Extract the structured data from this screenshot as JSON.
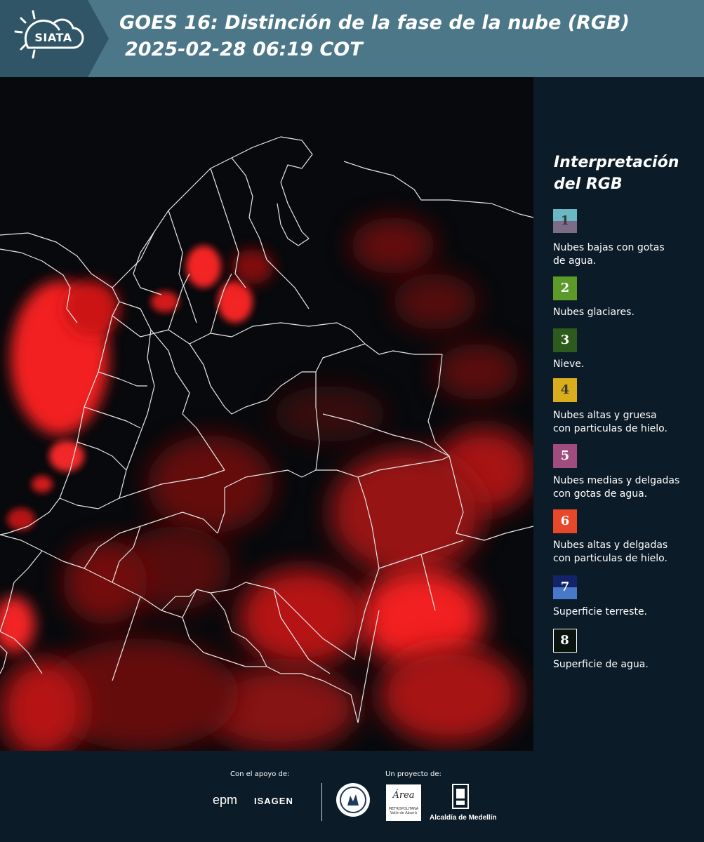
{
  "header": {
    "logo_text": "SIATA",
    "title_line1": "GOES 16: Distinción de la fase de la nube (RGB)",
    "title_line2": "2025-02-28 06:19 COT"
  },
  "legend": {
    "title_line1": "Interpretación",
    "title_line2": "del RGB",
    "items": [
      {
        "num": "1",
        "label_line1": "Nubes bajas con gotas",
        "label_line2": "de agua.",
        "color_top": "#6ab8c3",
        "color_bottom": "#7c6c88",
        "num_color": "#3a3a3a"
      },
      {
        "num": "2",
        "label_line1": "Nubes glaciares.",
        "label_line2": "",
        "color_top": "#5c9a2a",
        "color_bottom": "#5c9a2a",
        "num_color": "#ffffff"
      },
      {
        "num": "3",
        "label_line1": "Nieve.",
        "label_line2": "",
        "color_top": "#2d5a1d",
        "color_bottom": "#2d5a1d",
        "num_color": "#ffffff"
      },
      {
        "num": "4",
        "label_line1": "Nubes altas y gruesa",
        "label_line2": "con particulas de hielo.",
        "color_top": "#d9ad1b",
        "color_bottom": "#d9ad1b",
        "num_color": "#3a3a3a"
      },
      {
        "num": "5",
        "label_line1": "Nubes medias y delgadas",
        "label_line2": "con gotas de agua.",
        "color_top": "#a04c7e",
        "color_bottom": "#a04c7e",
        "num_color": "#ffffff"
      },
      {
        "num": "6",
        "label_line1": "Nubes altas y delgadas",
        "label_line2": "con particulas de hielo.",
        "color_top": "#e8482a",
        "color_bottom": "#e8482a",
        "num_color": "#ffffff"
      },
      {
        "num": "7",
        "label_line1": "Superficie terreste.",
        "label_line2": "",
        "color_top": "#12236a",
        "color_bottom": "#4a78c8",
        "num_color": "#ffffff"
      },
      {
        "num": "8",
        "label_line1": "Superficie de agua.",
        "label_line2": "",
        "color_top": "#0a140e",
        "color_bottom": "#0a140e",
        "num_color": "#ffffff"
      }
    ]
  },
  "footer": {
    "support_label": "Con el apoyo de:",
    "project_label": "Un proyecto de:",
    "epm": "epm",
    "isagen": "ISAGEN",
    "area_text": "Área",
    "area_sub": "METROPOLITANA Valle de Aburrá",
    "alcaldia": "Alcaldía de Medellín"
  }
}
